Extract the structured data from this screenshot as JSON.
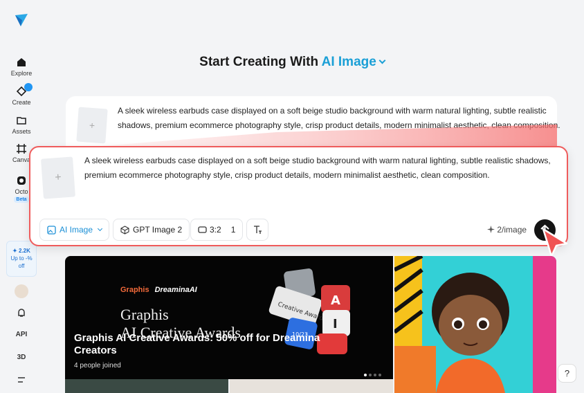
{
  "sidebar": {
    "items": [
      {
        "label": "Explore"
      },
      {
        "label": "Create"
      },
      {
        "label": "Assets"
      },
      {
        "label": "Canva"
      },
      {
        "label": "Octo",
        "badge": "Beta"
      }
    ],
    "credits": {
      "amount": "✦ 2.2K",
      "promo": "Up to -%",
      "promo2": "off"
    },
    "bottom": {
      "api": "API",
      "three_d": "3D"
    }
  },
  "header": {
    "title_prefix": "Start Creating With",
    "title_accent": "AI Image"
  },
  "prompt": {
    "text": "A sleek wireless earbuds case displayed on a soft beige studio background with warm natural lighting, subtle realistic shadows, premium ecommerce photography style, crisp product details, modern minimalist aesthetic, clean composition.",
    "thumb_plus": "+"
  },
  "toolbar": {
    "mode_label": "AI Image",
    "model_label": "GPT Image 2",
    "ratio_label": "3:2",
    "count_label": "1",
    "cost_label": "2/image"
  },
  "gallery": {
    "banner": {
      "brand": "Graphis",
      "brand2": "DreaminaAI",
      "big_line1": "Graphis",
      "big_line2": "AI Creative Awards",
      "title": "Graphis AI Creative Awards: 50% off for Dreamina Creators",
      "sub": "4 people joined",
      "key_label": "Creative Awards",
      "key_letter_a": "A",
      "key_letter_i": "I",
      "key_small": "10/23"
    }
  },
  "help": {
    "label": "?"
  },
  "colors": {
    "accent": "#1a9fd6",
    "highlight": "#ef5b5b",
    "badge": "#2196f3"
  }
}
